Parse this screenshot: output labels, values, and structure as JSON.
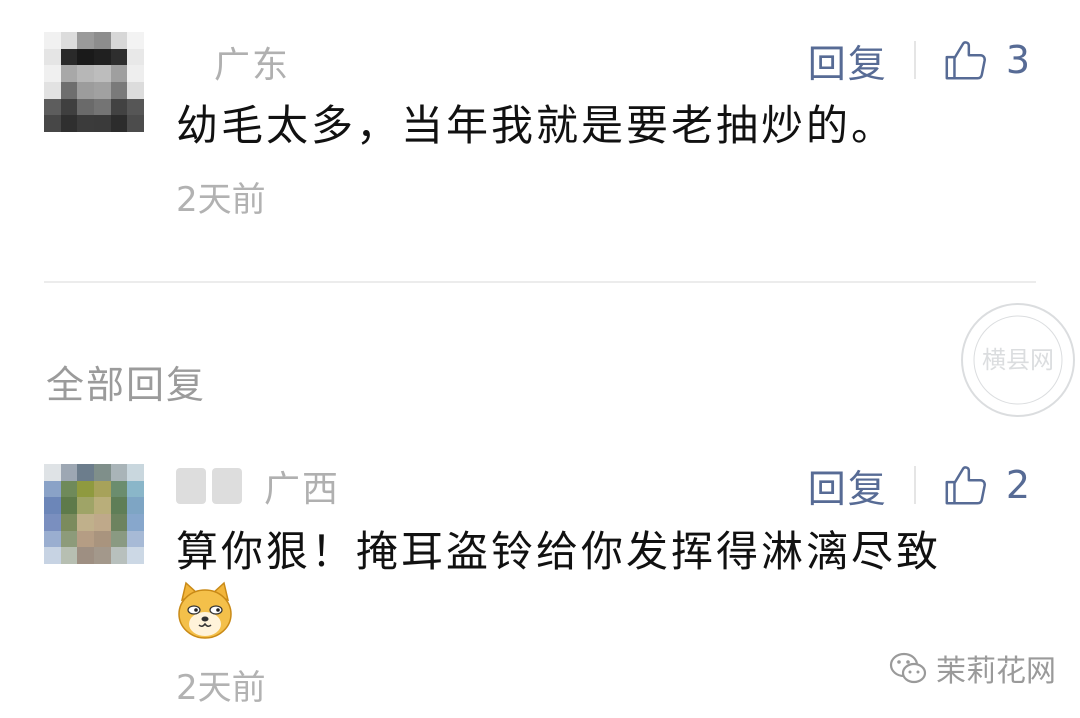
{
  "comments": [
    {
      "region": "广东",
      "reply_label": "回复",
      "likes": "3",
      "text": "幼毛太多，当年我就是要老抽炒的。",
      "time": "2天前"
    },
    {
      "region": "广西",
      "reply_label": "回复",
      "likes": "2",
      "text": "算你狠！掩耳盗铃给你发挥得淋漓尽致",
      "time": "2天前"
    }
  ],
  "section_title": "全部回复",
  "watermark": "茉莉花网",
  "seal_text": "横县网",
  "icons": {
    "like": "thumbs-up-icon",
    "emoji": "doge-emoji",
    "watermark": "wechat-icon"
  },
  "colors": {
    "link": "#576b95",
    "meta": "#b2b2b2",
    "text": "#111111"
  }
}
